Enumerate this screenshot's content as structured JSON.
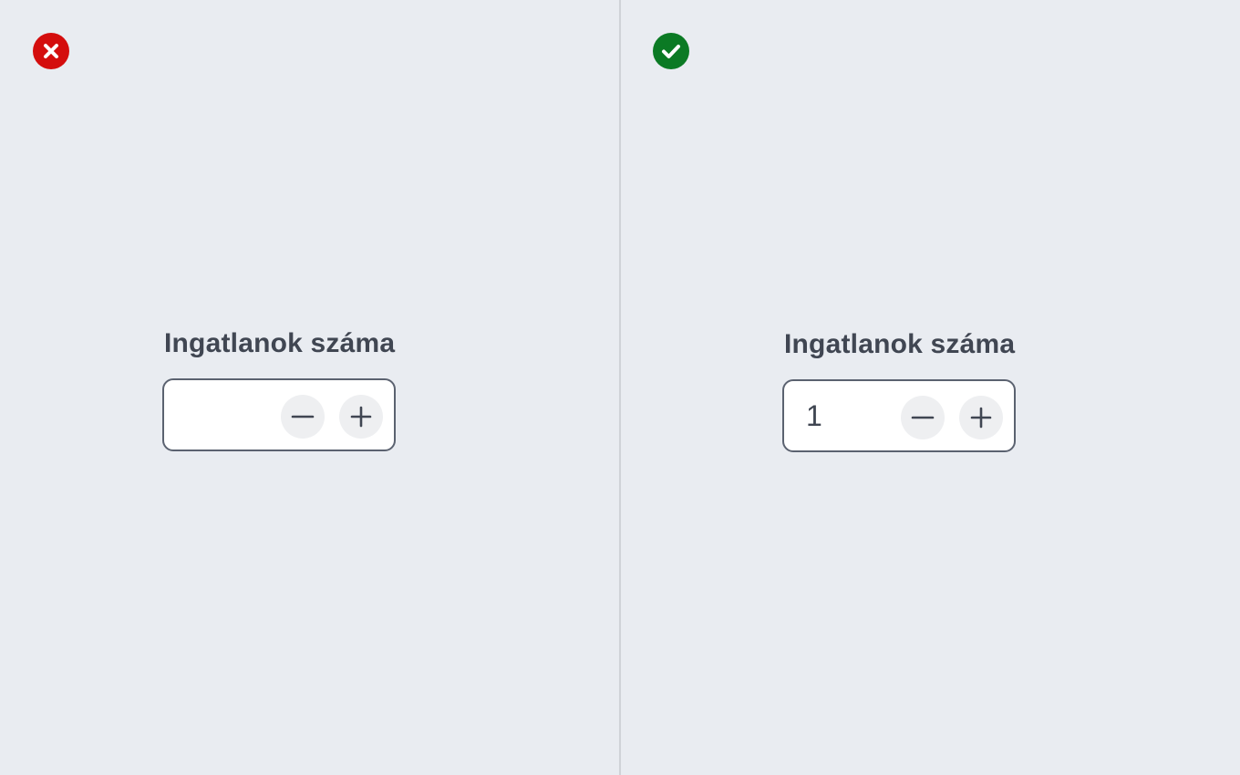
{
  "colors": {
    "background": "#e9ecf1",
    "bad": "#d40d0d",
    "good": "#0b7a24",
    "text": "#404652",
    "border": "#5b6270",
    "button_bg": "#eeeff1"
  },
  "left_example": {
    "status_icon": "error-x-icon",
    "label": "Ingatlanok száma",
    "value": "",
    "decrement_icon": "minus-icon",
    "increment_icon": "plus-icon"
  },
  "right_example": {
    "status_icon": "success-check-icon",
    "label": "Ingatlanok száma",
    "value": "1",
    "decrement_icon": "minus-icon",
    "increment_icon": "plus-icon"
  }
}
